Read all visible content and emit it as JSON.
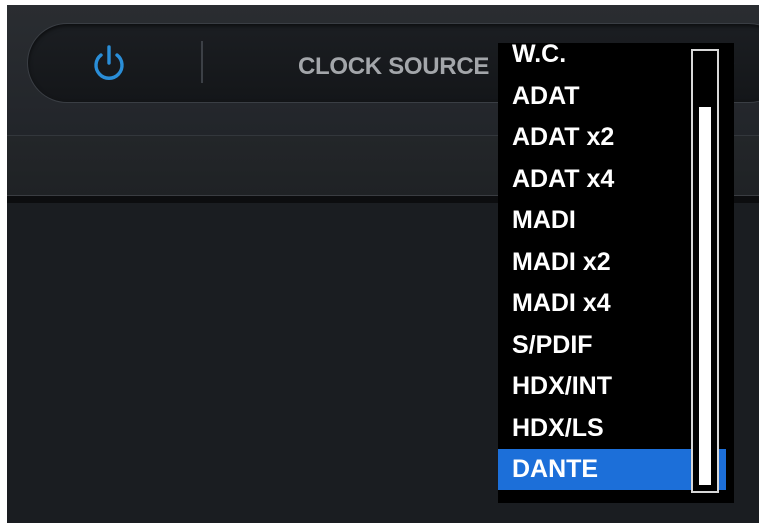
{
  "toolbar": {
    "power_icon": "power-icon",
    "clock_source_label": "CLOCK SOURCE",
    "dropdown_arrow_icon": "chevron-down-icon",
    "accent_color": "#2a8ed8"
  },
  "clock_menu": {
    "items": [
      {
        "label": "W.C."
      },
      {
        "label": "ADAT"
      },
      {
        "label": "ADAT x2"
      },
      {
        "label": "ADAT x4"
      },
      {
        "label": "MADI"
      },
      {
        "label": "MADI x2"
      },
      {
        "label": "MADI x4"
      },
      {
        "label": "S/PDIF"
      },
      {
        "label": "HDX/INT"
      },
      {
        "label": "HDX/LS"
      },
      {
        "label": "DANTE"
      }
    ],
    "selected": "DANTE",
    "selection_color": "#1c6fd9"
  }
}
